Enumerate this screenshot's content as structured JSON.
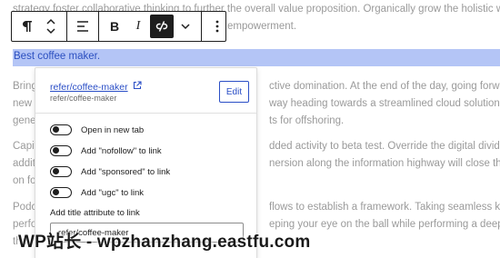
{
  "editor": {
    "para_top": "strategy foster collaborative thinking to further the overall value proposition. Organically grow the holistic world view",
    "para_top2": "empowerment.",
    "selected_text": "Best coffee maker.",
    "p2": [
      "Bring",
      "new r",
      "gener"
    ],
    "p2_right": [
      "ctive domination. At the end of the day, going forward, a",
      "way heading towards a streamlined cloud solution. User",
      "ts for offshoring."
    ],
    "p3": [
      "Capit",
      "additi",
      "on fo"
    ],
    "p3_right": [
      "dded activity to beta test. Override the digital divide with",
      "nersion along the information highway will close the loop",
      ""
    ],
    "p4": [
      "Podca",
      "perfo",
      "the"
    ],
    "p4_right": [
      "flows to establish a framework. Taking seamless key",
      "eping your eye on the ball while performing a deep dive on",
      ""
    ]
  },
  "toolbar": {
    "paragraph_icon": "pilcrow-icon",
    "move_icon": "chevron-up-down-icon",
    "align_icon": "align-left-icon",
    "bold_label": "B",
    "italic_label": "I",
    "link_icon": "unlink-icon",
    "more_formats_icon": "chevron-down-icon",
    "options_icon": "vertical-ellipsis-icon"
  },
  "link_popover": {
    "link_text": "refer/coffee-maker",
    "link_sub": "refer/coffee-maker",
    "edit_label": "Edit",
    "external_icon": "external-link-icon",
    "toggles": [
      {
        "label": "Open in new tab",
        "checked": false
      },
      {
        "label": "Add \"nofollow\" to link",
        "checked": false
      },
      {
        "label": "Add \"sponsored\" to link",
        "checked": false
      },
      {
        "label": "Add \"ugc\" to link",
        "checked": false
      }
    ],
    "title_label": "Add title attribute to link",
    "title_value": "refer/coffee-maker"
  },
  "watermark": "WP站长 - wpzhanzhang.eastfu.com"
}
